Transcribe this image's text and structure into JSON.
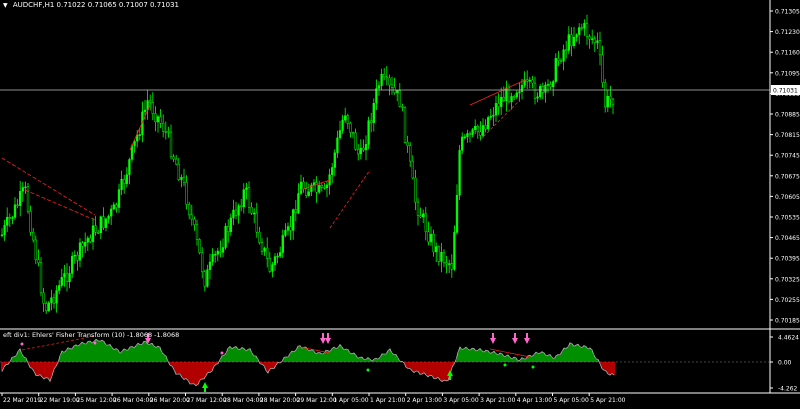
{
  "header": {
    "symbol_label": "AUDCHF,H1",
    "ohlc": "0.71022 0.71065 0.71007 0.71031",
    "dropdown_glyph": "▼"
  },
  "price_axis": {
    "ticks": [
      "0.71305",
      "0.71230",
      "0.71160",
      "0.71095",
      "0.70955",
      "0.70885",
      "0.70815",
      "0.70745",
      "0.70675",
      "0.70605",
      "0.70535",
      "0.70465",
      "0.70395",
      "0.70325",
      "0.70255",
      "0.70185"
    ],
    "current_price": "0.71031"
  },
  "indicator": {
    "title": "eft div1: Ehlers' Fisher Transform (10) -1.8068 -1.8068",
    "ticks": [
      "4.4624",
      "0.00",
      "-4.262"
    ]
  },
  "time_axis": {
    "labels": [
      "22 Mar 2019",
      "22 Mar 19:00",
      "25 Mar 12:00",
      "26 Mar 04:00",
      "26 Mar 20:00",
      "27 Mar 12:00",
      "28 Mar 04:00",
      "28 Mar 20:00",
      "29 Mar 12:00",
      "1 Apr 05:00",
      "1 Apr 21:00",
      "2 Apr 13:00",
      "3 Apr 05:00",
      "3 Apr 21:00",
      "4 Apr 13:00",
      "5 Apr 05:00",
      "5 Apr 21:00"
    ]
  },
  "colors": {
    "background": "#000000",
    "bull": "#00ff00",
    "bear": "#000000",
    "bar_outline": "#00ff00",
    "hist_pos": "#00cc00",
    "hist_neg": "#ff0000",
    "fisher_line": "#aaaaaa",
    "divergence": "#ff2020",
    "arrow_down": "#ff66cc",
    "arrow_up": "#00ff00",
    "axis_text": "#ffffff",
    "price_line": "#c0c0c0"
  }
}
